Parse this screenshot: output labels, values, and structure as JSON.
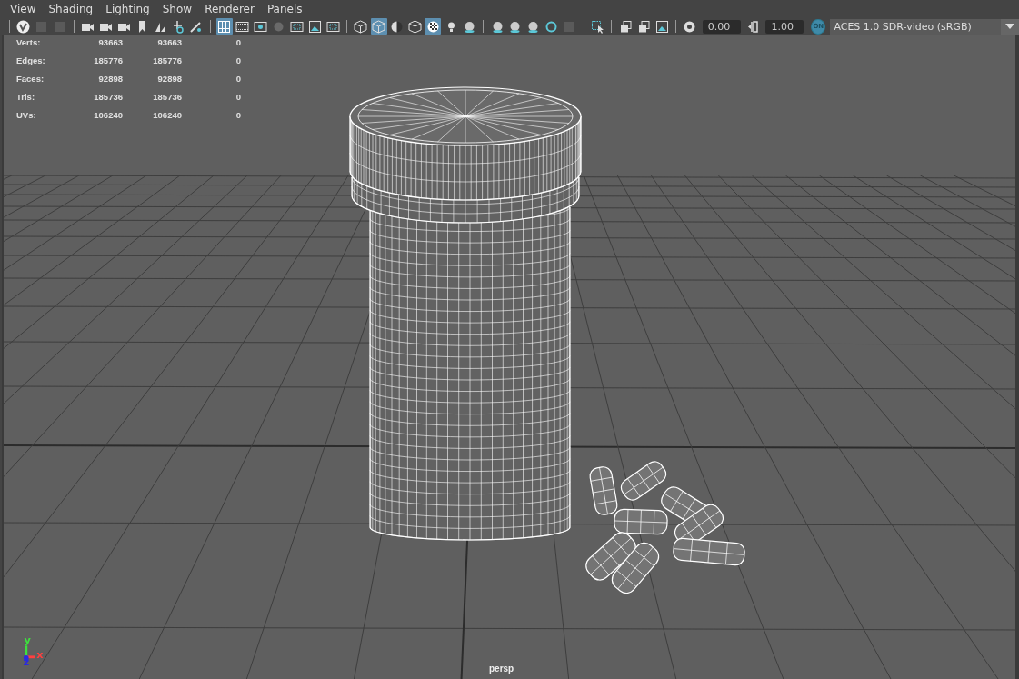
{
  "menu": [
    {
      "label": "View"
    },
    {
      "label": "Shading"
    },
    {
      "label": "Lighting"
    },
    {
      "label": "Show"
    },
    {
      "label": "Renderer"
    },
    {
      "label": "Panels"
    }
  ],
  "toolbar": [
    {
      "kind": "sep"
    },
    {
      "kind": "logo",
      "selected": false
    },
    {
      "kind": "dim",
      "selected": false
    },
    {
      "kind": "dim",
      "selected": false
    },
    {
      "kind": "sep"
    },
    {
      "kind": "camera",
      "selected": false
    },
    {
      "kind": "camera",
      "selected": false
    },
    {
      "kind": "camera",
      "selected": false
    },
    {
      "kind": "bookmark",
      "selected": false
    },
    {
      "kind": "planes",
      "selected": false
    },
    {
      "kind": "move",
      "selected": false
    },
    {
      "kind": "pen",
      "selected": false
    },
    {
      "kind": "sep"
    },
    {
      "kind": "grid",
      "selected": true
    },
    {
      "kind": "film",
      "selected": false
    },
    {
      "kind": "target",
      "selected": false
    },
    {
      "kind": "dimcircle",
      "selected": false
    },
    {
      "kind": "frame",
      "selected": false
    },
    {
      "kind": "image",
      "selected": false
    },
    {
      "kind": "frame",
      "selected": false
    },
    {
      "kind": "sep"
    },
    {
      "kind": "cube",
      "selected": false
    },
    {
      "kind": "cube",
      "selected": true
    },
    {
      "kind": "halfsphere",
      "selected": false
    },
    {
      "kind": "cube",
      "selected": false
    },
    {
      "kind": "checker",
      "selected": true
    },
    {
      "kind": "bulb",
      "selected": false
    },
    {
      "kind": "sphere",
      "selected": false
    },
    {
      "kind": "sep"
    },
    {
      "kind": "sphere",
      "selected": false
    },
    {
      "kind": "sphere",
      "selected": false
    },
    {
      "kind": "sphere",
      "selected": false
    },
    {
      "kind": "ring",
      "selected": false
    },
    {
      "kind": "dim",
      "selected": false
    },
    {
      "kind": "sep"
    },
    {
      "kind": "cursor",
      "selected": false
    },
    {
      "kind": "sep"
    },
    {
      "kind": "stack",
      "selected": false
    },
    {
      "kind": "stack",
      "selected": false
    },
    {
      "kind": "image",
      "selected": false
    },
    {
      "kind": "sep"
    },
    {
      "kind": "aperture",
      "selected": false
    },
    {
      "kind": "field",
      "value": "0.00"
    },
    {
      "kind": "gamma",
      "selected": false
    },
    {
      "kind": "field",
      "value": "1.00"
    },
    {
      "kind": "badge",
      "text": "ON",
      "selected": true
    },
    {
      "kind": "dropdown",
      "value": "ACES 1.0 SDR-video (sRGB)"
    }
  ],
  "hud": [
    {
      "label": "Verts:",
      "values": [
        "93663",
        "93663",
        "0"
      ]
    },
    {
      "label": "Edges:",
      "values": [
        "185776",
        "185776",
        "0"
      ]
    },
    {
      "label": "Faces:",
      "values": [
        "92898",
        "92898",
        "0"
      ]
    },
    {
      "label": "Tris:",
      "values": [
        "185736",
        "185736",
        "0"
      ]
    },
    {
      "label": "UVs:",
      "values": [
        "106240",
        "106240",
        "0"
      ]
    }
  ],
  "axes": [
    {
      "label": "y",
      "color": "#3ee03e"
    },
    {
      "label": "x",
      "color": "#ff4040"
    },
    {
      "label": "z",
      "color": "#2a2ae0"
    }
  ],
  "camera_label": "persp"
}
